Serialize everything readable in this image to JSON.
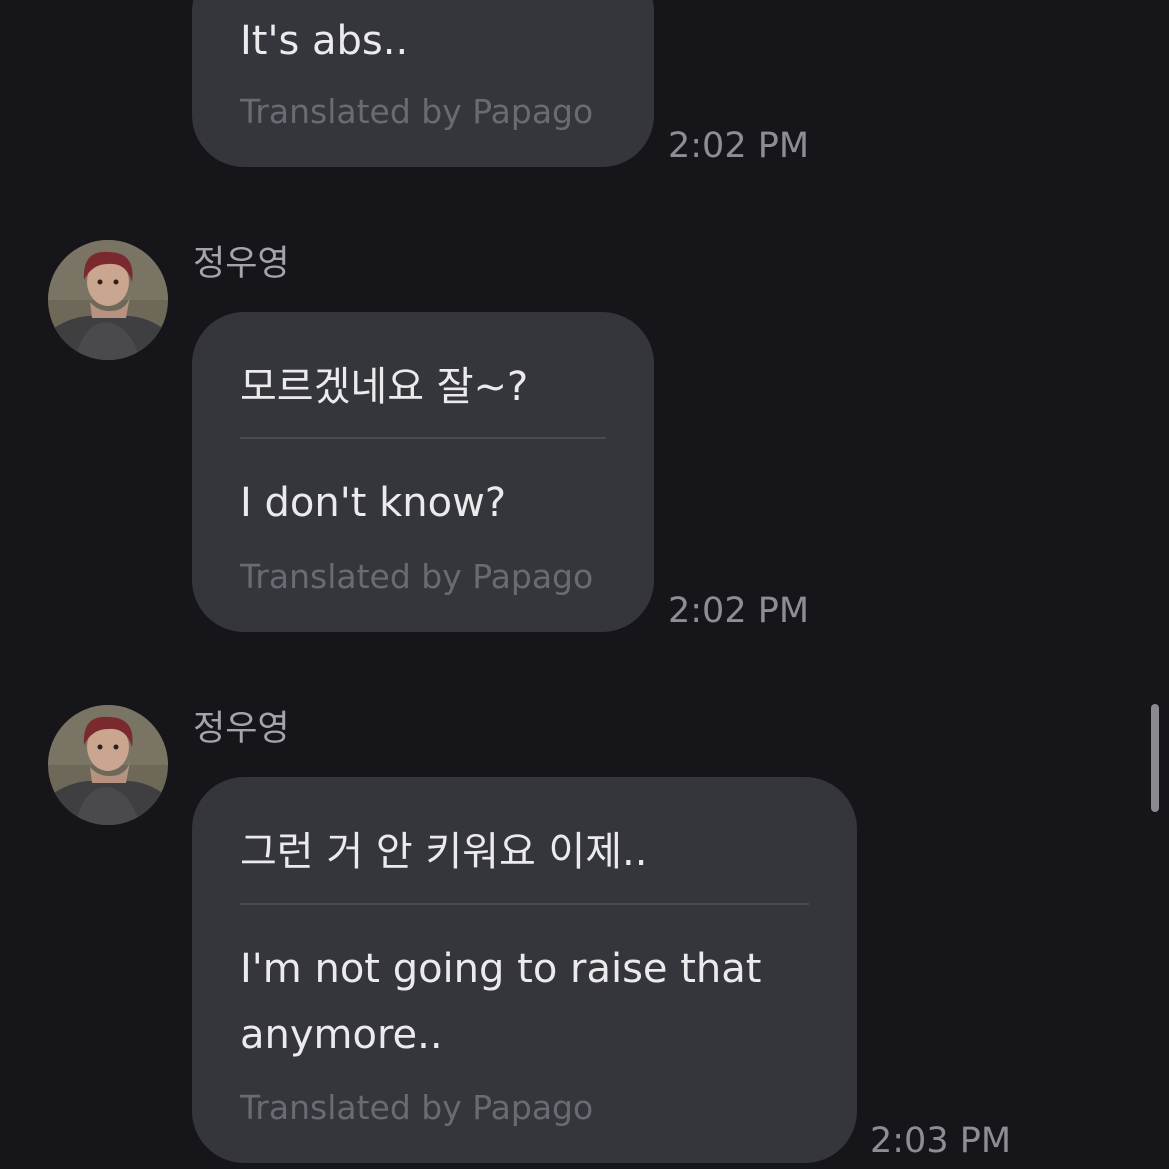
{
  "messages": [
    {
      "original": "",
      "translation": "It's abs..",
      "credit": "Translated by Papago",
      "time": "2:02 PM"
    },
    {
      "sender": "정우영",
      "original": "모르겠네요 잘~?",
      "translation": "I don't know?",
      "credit": "Translated by Papago",
      "time": "2:02 PM"
    },
    {
      "sender": "정우영",
      "original": "그런 거 안 키워요 이제..",
      "translation_lines": [
        "I'm not going to raise that",
        "anymore.."
      ],
      "credit": "Translated by Papago",
      "time": "2:03 PM"
    }
  ],
  "colors": {
    "background": "#16161a",
    "bubble": "#35353c",
    "text": "#ebebee",
    "meta_text": "#6a6a72",
    "timestamp": "#8d8d94"
  },
  "icons": {
    "avatar": "profile-photo"
  }
}
